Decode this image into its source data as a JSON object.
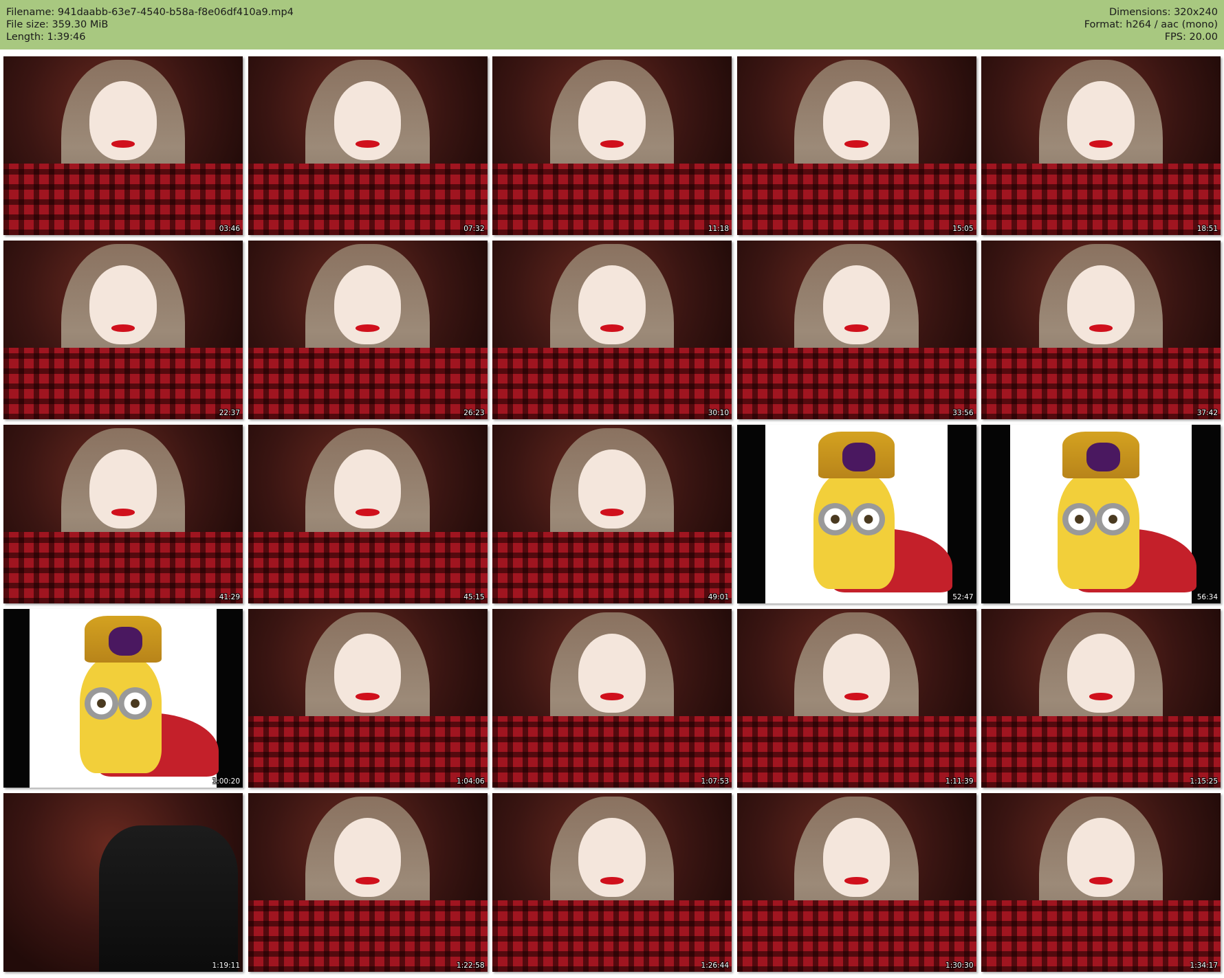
{
  "header": {
    "filename_label": "Filename:",
    "filename": "941daabb-63e7-4540-b58a-f8e06df410a9.mp4",
    "filesize_label": "File size:",
    "filesize": "359.30 MiB",
    "length_label": "Length:",
    "length": "1:39:46",
    "dimensions_label": "Dimensions:",
    "dimensions": "320x240",
    "format_label": "Format:",
    "format": "h264 / aac (mono)",
    "fps_label": "FPS:",
    "fps": "20.00",
    "background_color": "#a8c880"
  },
  "thumbnails": [
    {
      "timestamp": "03:46",
      "kind": "webcam"
    },
    {
      "timestamp": "07:32",
      "kind": "webcam"
    },
    {
      "timestamp": "11:18",
      "kind": "webcam"
    },
    {
      "timestamp": "15:05",
      "kind": "webcam"
    },
    {
      "timestamp": "18:51",
      "kind": "webcam"
    },
    {
      "timestamp": "22:37",
      "kind": "webcam"
    },
    {
      "timestamp": "26:23",
      "kind": "webcam"
    },
    {
      "timestamp": "30:10",
      "kind": "webcam"
    },
    {
      "timestamp": "33:56",
      "kind": "webcam"
    },
    {
      "timestamp": "37:42",
      "kind": "webcam"
    },
    {
      "timestamp": "41:29",
      "kind": "webcam"
    },
    {
      "timestamp": "45:15",
      "kind": "webcam"
    },
    {
      "timestamp": "49:01",
      "kind": "webcam"
    },
    {
      "timestamp": "52:47",
      "kind": "minion"
    },
    {
      "timestamp": "56:34",
      "kind": "minion"
    },
    {
      "timestamp": "1:00:20",
      "kind": "minion-left"
    },
    {
      "timestamp": "1:04:06",
      "kind": "webcam"
    },
    {
      "timestamp": "1:07:53",
      "kind": "webcam"
    },
    {
      "timestamp": "1:11:39",
      "kind": "webcam"
    },
    {
      "timestamp": "1:15:25",
      "kind": "webcam"
    },
    {
      "timestamp": "1:19:11",
      "kind": "chair"
    },
    {
      "timestamp": "1:22:58",
      "kind": "webcam"
    },
    {
      "timestamp": "1:26:44",
      "kind": "webcam"
    },
    {
      "timestamp": "1:30:30",
      "kind": "webcam"
    },
    {
      "timestamp": "1:34:17",
      "kind": "webcam"
    }
  ]
}
